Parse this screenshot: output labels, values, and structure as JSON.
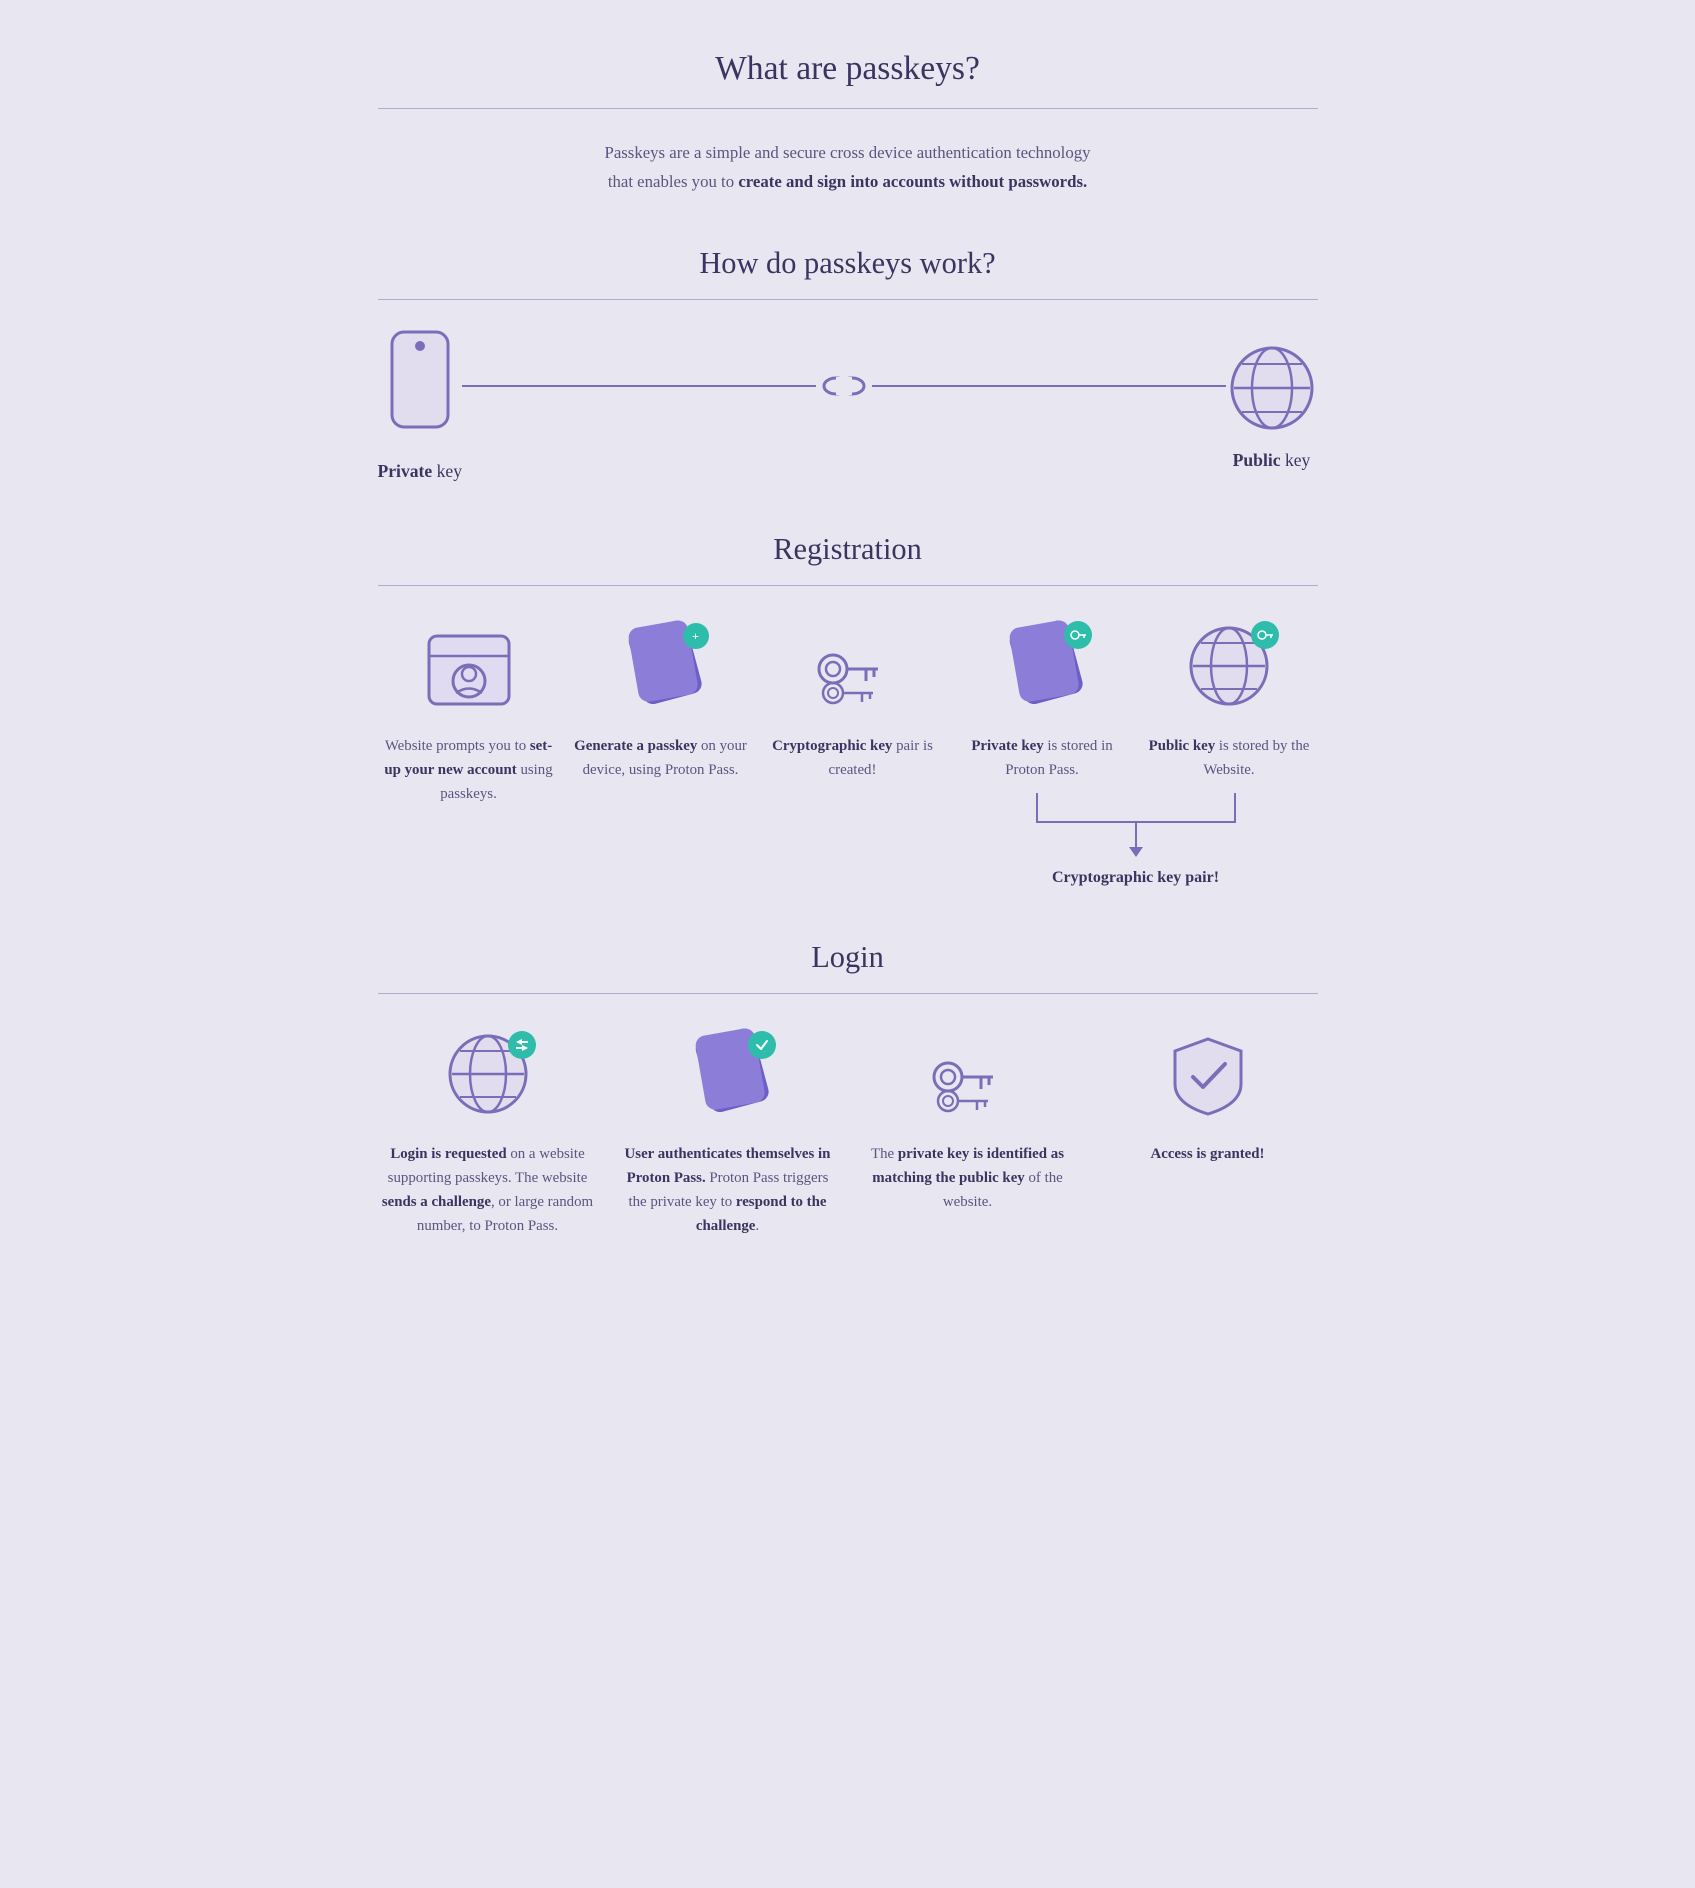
{
  "page": {
    "title": "What are passkeys?",
    "intro": {
      "line1": "Passkeys are a simple and secure cross device authentication technology",
      "line2": "that enables you to ",
      "bold": "create and sign into accounts without passwords."
    },
    "how_title": "How do passkeys work?",
    "private_key_label": "Private",
    "private_key_suffix": " key",
    "public_key_label": "Public",
    "public_key_suffix": " key",
    "registration": {
      "title": "Registration",
      "steps": [
        {
          "id": "reg1",
          "text_plain": "Website prompts you to ",
          "text_bold": "set-up your new account",
          "text_plain2": " using passkeys."
        },
        {
          "id": "reg2",
          "text_bold": "Generate a passkey",
          "text_plain": " on your device, using Proton Pass."
        },
        {
          "id": "reg3",
          "text_bold": "Cryptographic key",
          "text_plain": " pair is created!"
        },
        {
          "id": "reg4",
          "text_bold": "Private key",
          "text_plain": " is stored in Proton Pass."
        },
        {
          "id": "reg5",
          "text_bold": "Public key",
          "text_plain": " is stored by the Website."
        }
      ],
      "keypair_label": "Cryptographic key pair!"
    },
    "login": {
      "title": "Login",
      "steps": [
        {
          "id": "login1",
          "text_bold": "Login is requested",
          "text_plain": " on a website supporting passkeys. The website ",
          "text_bold2": "sends a challenge",
          "text_plain2": ", or large random number, to Proton Pass."
        },
        {
          "id": "login2",
          "text_bold": "User authenticates themselves in Proton Pass.",
          "text_plain": " Proton Pass triggers the private key to ",
          "text_bold2": "respond to the challenge",
          "text_plain2": "."
        },
        {
          "id": "login3",
          "text_plain": "The ",
          "text_bold": "private key is identified as matching the public key",
          "text_plain2": " of the website."
        },
        {
          "id": "login4",
          "text_bold": "Access is granted!"
        }
      ]
    }
  },
  "colors": {
    "purple": "#6c5fc7",
    "light_purple": "#8b7dd8",
    "teal": "#2dbdaa",
    "bg": "#e8e6f0",
    "text_dark": "#3a3560",
    "text_muted": "#5a5580"
  }
}
